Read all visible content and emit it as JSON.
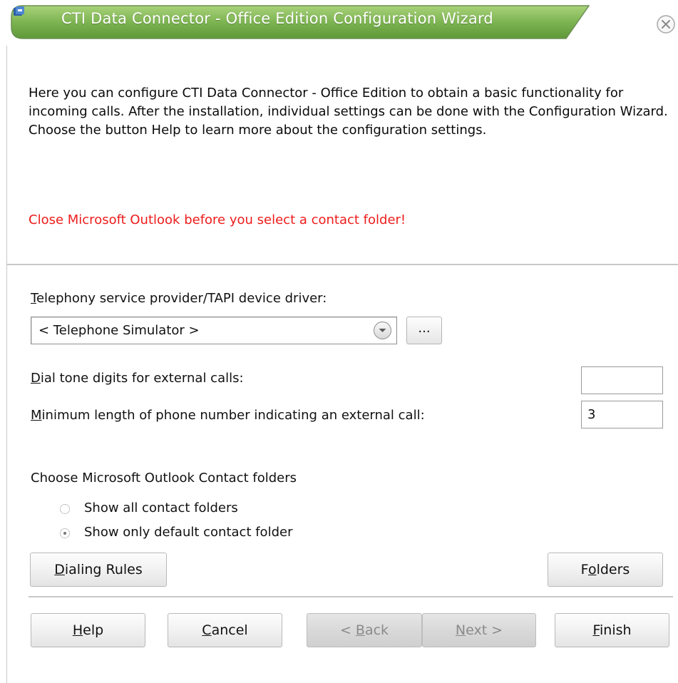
{
  "window": {
    "title": "CTI Data Connector - Office Edition Configuration Wizard",
    "close_icon": "close-icon",
    "app_icon": "app-icon",
    "title_bar_color": "#74a84c"
  },
  "intro": {
    "description": "Here you can configure CTI Data Connector - Office Edition to obtain a basic functionality for incoming calls. After the installation, individual settings can be done with the Configuration Wizard. Choose the button Help to learn more about the configuration settings.",
    "warning": "Close Microsoft Outlook before you select a contact folder!",
    "warning_color": "#ee1c1c"
  },
  "form": {
    "tapi_label_first": "T",
    "tapi_label_rest": "elephony service provider/TAPI device driver:",
    "tapi_selected": "< Telephone Simulator >",
    "browse_label": "...",
    "dial_tone_label_first": "D",
    "dial_tone_label_rest": "ial tone digits for external calls:",
    "dial_tone_value": "",
    "min_length_label_first": "M",
    "min_length_label_rest": "inimum length of phone number indicating an external call:",
    "min_length_value": "3",
    "contact_folders_heading": "Choose Microsoft Outlook Contact folders",
    "radio_all_label": "Show all contact folders",
    "radio_default_label": "Show only default contact folder",
    "selected_radio": "Show only default contact folder",
    "dialing_rules_first": "D",
    "dialing_rules_rest": "ialing Rules",
    "folders_before": "F",
    "folders_accel": "o",
    "folders_after": "lders"
  },
  "footer": {
    "help_accel": "H",
    "help_rest": "elp",
    "cancel_accel": "C",
    "cancel_rest": "ancel",
    "back_prefix": "< ",
    "back_accel": "B",
    "back_rest": "ack",
    "next_accel": "N",
    "next_rest": "ext >",
    "finish_accel": "F",
    "finish_rest": "inish"
  }
}
